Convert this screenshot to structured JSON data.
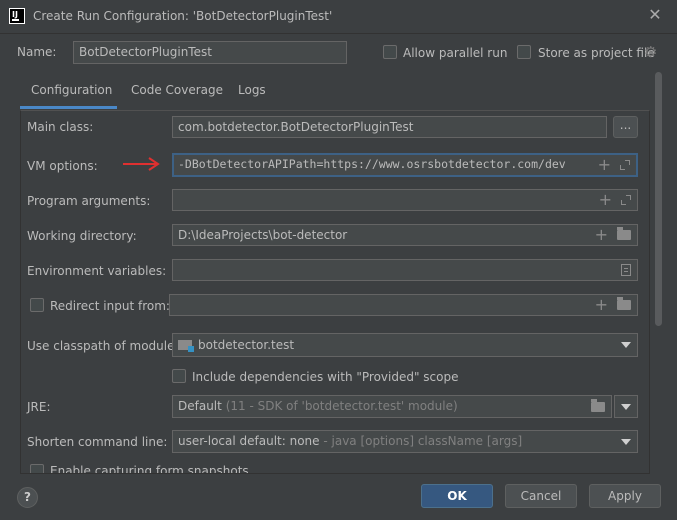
{
  "window": {
    "title": "Create Run Configuration: 'BotDetectorPluginTest'",
    "app_icon_text": "IJ"
  },
  "header": {
    "name_label": "Name:",
    "name_value": "BotDetectorPluginTest",
    "allow_parallel_label": "Allow parallel run",
    "store_as_project_label": "Store as project file"
  },
  "tabs": [
    {
      "label": "Configuration",
      "active": true
    },
    {
      "label": "Code Coverage",
      "active": false
    },
    {
      "label": "Logs",
      "active": false
    }
  ],
  "form": {
    "main_class_label": "Main class:",
    "main_class_value": "com.botdetector.BotDetectorPluginTest",
    "browse_label": "...",
    "vm_options_label": "VM options:",
    "vm_options_value": "-DBotDetectorAPIPath=https://www.osrsbotdetector.com/dev",
    "program_args_label": "Program arguments:",
    "program_args_value": "",
    "working_dir_label": "Working directory:",
    "working_dir_value": "D:\\IdeaProjects\\bot-detector",
    "env_vars_label": "Environment variables:",
    "env_vars_value": "",
    "redirect_input_label": "Redirect input from:",
    "redirect_input_value": "",
    "classpath_label": "Use classpath of module:",
    "classpath_value": "botdetector.test",
    "include_deps_label": "Include dependencies with \"Provided\" scope",
    "jre_label": "JRE:",
    "jre_value": "Default",
    "jre_hint": "(11 - SDK of 'botdetector.test' module)",
    "shorten_label": "Shorten command line:",
    "shorten_value": "user-local default: none",
    "shorten_hint": "- java [options] className [args]",
    "capture_snapshots_label": "Enable capturing form snapshots"
  },
  "footer": {
    "help_label": "?",
    "ok_label": "OK",
    "cancel_label": "Cancel",
    "apply_label": "Apply"
  },
  "colors": {
    "background": "#3c3f41",
    "field": "#45494a",
    "focus_border": "#3d6185",
    "tab_underline": "#4a88c7",
    "primary_button": "#365880",
    "annotation_arrow": "#e03030"
  }
}
